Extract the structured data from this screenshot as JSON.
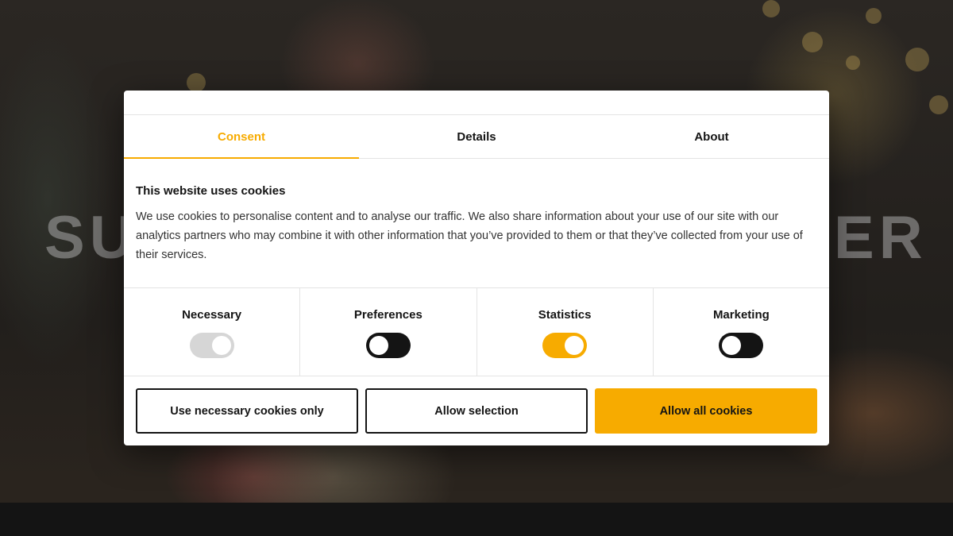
{
  "hero": {
    "text_left": "SU",
    "text_right": "ER"
  },
  "tabs": [
    {
      "label": "Consent",
      "active": true
    },
    {
      "label": "Details",
      "active": false
    },
    {
      "label": "About",
      "active": false
    }
  ],
  "content": {
    "title": "This website uses cookies",
    "text": "We use cookies to personalise content and to analyse our traffic. We also share information about your use of our site with our analytics partners who may combine it with other information that you’ve provided to them or that they’ve collected from your use of their services."
  },
  "toggles": [
    {
      "label": "Necessary",
      "state": "on",
      "disabled": true
    },
    {
      "label": "Preferences",
      "state": "off",
      "disabled": false
    },
    {
      "label": "Statistics",
      "state": "on",
      "disabled": false
    },
    {
      "label": "Marketing",
      "state": "off",
      "disabled": false
    }
  ],
  "buttons": {
    "necessary_only": "Use necessary cookies only",
    "allow_selection": "Allow selection",
    "allow_all": "Allow all cookies"
  },
  "colors": {
    "accent": "#f7ab00",
    "dark": "#141414",
    "disabled": "#d6d6d6"
  }
}
